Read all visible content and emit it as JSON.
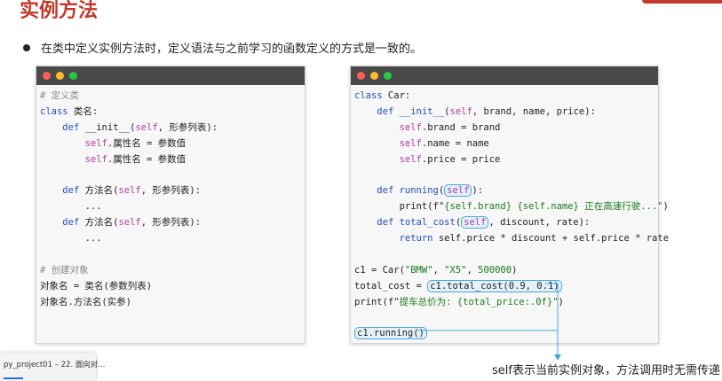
{
  "slide": {
    "title": "实例方法",
    "bullet": "在类中定义实例方法时，定义语法与之前学习的函数定义的方式是一致的。"
  },
  "left_code": {
    "l1": "# 定义类",
    "l2_kw": "class",
    "l2_rest": " 类名:",
    "l3_kw": "def",
    "l3_a": " __init__(",
    "l3_self": "self",
    "l3_b": ", 形参列表):",
    "l4_self": "self",
    "l4_rest": ".属性名 = 参数值",
    "l5_self": "self",
    "l5_rest": ".属性名 = 参数值",
    "l7_kw": "def",
    "l7_a": " 方法名(",
    "l7_self": "self",
    "l7_b": ", 形参列表):",
    "l8": "...",
    "l9_kw": "def",
    "l9_a": " 方法名(",
    "l9_self": "self",
    "l9_b": ", 形参列表):",
    "l10": "...",
    "l12": "# 创建对象",
    "l13": "对象名 = 类名(参数列表)",
    "l14": "对象名.方法名(实参)"
  },
  "right_code": {
    "r1_kw": "class",
    "r1_rest": " Car:",
    "r2_kw": "def",
    "r2_fn": " __init__",
    "r2_a": "(",
    "r2_self": "self",
    "r2_b": ", brand, name, price):",
    "r3_self": "self",
    "r3_rest": ".brand = brand",
    "r4_self": "self",
    "r4_rest": ".name = name",
    "r5_self": "self",
    "r5_rest": ".price = price",
    "r7_kw": "def",
    "r7_fn": " running",
    "r7_a": "(",
    "r7_self": "self",
    "r7_b": "):",
    "r8_a": "print(f\"",
    "r8_b": "{self.brand} {self.name} 正在高速行驶...\"",
    "r8_c": ")",
    "r9_kw": "def",
    "r9_fn": " total_cost",
    "r9_a": "(",
    "r9_self": "self",
    "r9_b": ", discount, rate):",
    "r10_kw": "return",
    "r10_rest": " self.price * discount + self.price * rate",
    "r12_a": "c1 = Car(",
    "r12_s1": "\"BMW\"",
    "r12_c": ", ",
    "r12_s2": "\"X5\"",
    "r12_d": ", ",
    "r12_n": "500000",
    "r12_e": ")",
    "r13_a": "total_cost = ",
    "r13_call": "c1.total_cost(0.9, 0.1)",
    "r14_a": "print(f\"",
    "r14_b": "提车总价为: {total_price:.0f}\"",
    "r14_c": ")",
    "r16_call": "c1.running()"
  },
  "annotation": "self表示当前实例对象，方法调用时无需传递",
  "taskbar": {
    "label": "py_project01 – 22. 面向对..."
  },
  "colors": {
    "title": "#c0392b",
    "keyword": "#1f4fbf",
    "self": "#b03aa0",
    "string": "#1a7a1a",
    "highlight_border": "#4aa8d8"
  }
}
